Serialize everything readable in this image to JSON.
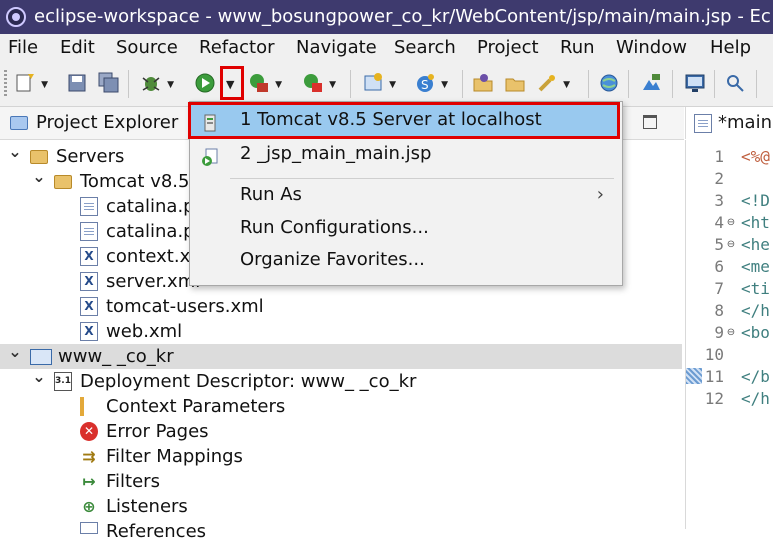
{
  "window": {
    "title": "eclipse-workspace - www_bosungpower_co_kr/WebContent/jsp/main/main.jsp - Ec"
  },
  "menu": [
    "File",
    "Edit",
    "Source",
    "Refactor",
    "Navigate",
    "Search",
    "Project",
    "Run",
    "Window",
    "Help"
  ],
  "toolbar": {
    "icons": [
      "new-icon",
      "save-icon",
      "save-all-icon",
      "debug-icon",
      "run-icon",
      "run-dropdown-icon",
      "coverage-icon",
      "external-tools-icon",
      "new-server-icon",
      "new-class-icon",
      "open-type-icon",
      "open-resource-icon",
      "search-icon",
      "browser-icon",
      "open-perspective-icon",
      "console-icon",
      "pin-icon"
    ],
    "highlight_color": "#e00000"
  },
  "project_explorer": {
    "title": "Project Explorer",
    "tree": [
      {
        "label": "Servers",
        "icon": "folder-icon",
        "indent": 0,
        "twisty": "open"
      },
      {
        "label": "Tomcat v8.5",
        "icon": "folder-icon",
        "indent": 1,
        "twisty": "open"
      },
      {
        "label": "catalina.p",
        "icon": "file-icon",
        "indent": 2
      },
      {
        "label": "catalina.p",
        "icon": "file-icon",
        "indent": 2
      },
      {
        "label": "context.x",
        "icon": "xml-icon",
        "indent": 2
      },
      {
        "label": "server.xml",
        "icon": "xml-icon",
        "indent": 2
      },
      {
        "label": "tomcat-users.xml",
        "icon": "xml-icon",
        "indent": 2
      },
      {
        "label": "web.xml",
        "icon": "xml-icon",
        "indent": 2
      },
      {
        "label": "www_              _co_kr",
        "icon": "project-icon",
        "indent": 0,
        "twisty": "open",
        "selected": true
      },
      {
        "label": "Deployment Descriptor: www_                    _co_kr",
        "icon": "deployment-descriptor-icon",
        "indent": 1,
        "twisty": "open"
      },
      {
        "label": "Context Parameters",
        "icon": "context-params-icon",
        "indent": 2
      },
      {
        "label": "Error Pages",
        "icon": "error-pages-icon",
        "indent": 2
      },
      {
        "label": "Filter Mappings",
        "icon": "filter-mappings-icon",
        "indent": 2
      },
      {
        "label": "Filters",
        "icon": "filters-icon",
        "indent": 2
      },
      {
        "label": "Listeners",
        "icon": "listeners-icon",
        "indent": 2
      },
      {
        "label": "References",
        "icon": "references-icon",
        "indent": 2
      }
    ]
  },
  "editor": {
    "tab_label": "*main.",
    "lines": [
      {
        "n": "1",
        "text": "<%@",
        "fold": ""
      },
      {
        "n": "2",
        "text": "",
        "fold": ""
      },
      {
        "n": "3",
        "text": "<!D",
        "fold": ""
      },
      {
        "n": "4",
        "text": "<ht",
        "fold": "⊖"
      },
      {
        "n": "5",
        "text": "<he",
        "fold": "⊖"
      },
      {
        "n": "6",
        "text": "<me",
        "fold": ""
      },
      {
        "n": "7",
        "text": "<ti",
        "fold": ""
      },
      {
        "n": "8",
        "text": "</h",
        "fold": ""
      },
      {
        "n": "9",
        "text": "<bo",
        "fold": "⊖"
      },
      {
        "n": "10",
        "text": "",
        "fold": ""
      },
      {
        "n": "11",
        "text": "</b",
        "fold": ""
      },
      {
        "n": "12",
        "text": "</h",
        "fold": ""
      }
    ]
  },
  "run_dropdown": {
    "items": [
      {
        "label": "1 Tomcat v8.5 Server at localhost",
        "icon": "tomcat-server-icon",
        "highlighted": true
      },
      {
        "label": "2 _jsp_main_main.jsp",
        "icon": "run-jsp-icon"
      },
      {
        "separator": true
      },
      {
        "label": "Run As",
        "submenu": true
      },
      {
        "label": "Run Configurations...",
        "submenu": false
      },
      {
        "label": "Organize Favorites...",
        "submenu": false
      }
    ],
    "submenu_arrow": "›"
  }
}
